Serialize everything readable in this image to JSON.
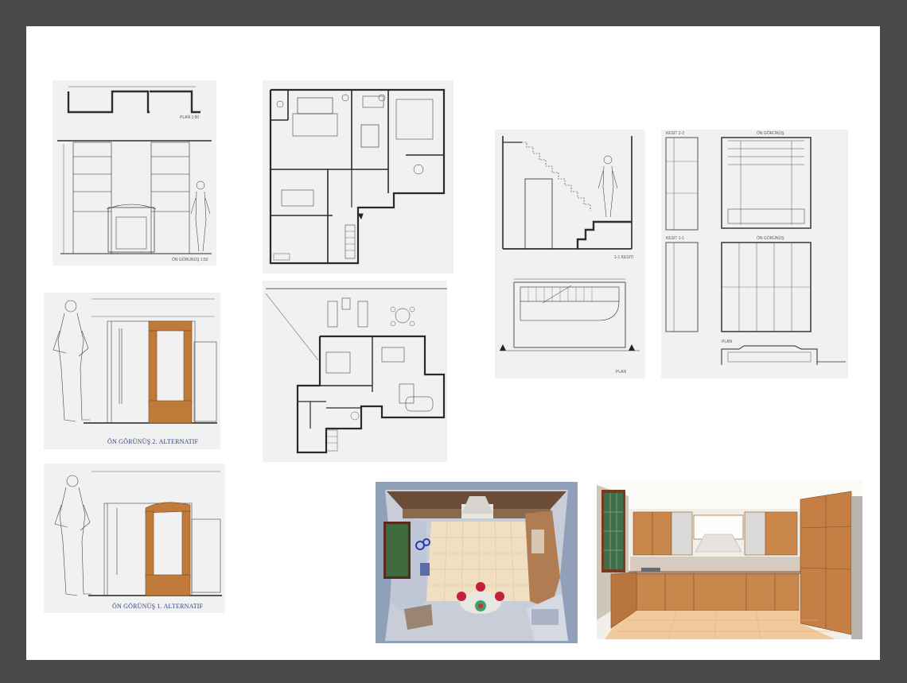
{
  "sheet": {
    "panels": {
      "plan_elevation": {
        "plan_label": "PLAN 1:50",
        "view_label": "ÖN GÖRÜNÜŞ 1:50"
      },
      "front_alt2": {
        "caption": "ÖN GÖRÜNÜŞ  2. ALTERNATIF"
      },
      "front_alt1": {
        "caption": "ÖN GÖRÜNÜŞ  1. ALTERNATIF"
      },
      "stair": {
        "section_label": "1-1 KESITI",
        "plan_label": "PLAN"
      },
      "cabinet": {
        "label_a": "KESIT 2-2",
        "label_b": "ÖN GÖRÜNÜŞ",
        "label_c": "KESIT 1-1",
        "label_d": "ÖN GÖRÜNÜŞ",
        "label_e": "PLAN"
      }
    },
    "colors": {
      "wood": "#c07a3a",
      "line": "#3a3a3a",
      "blue_caption": "#2b3f86"
    }
  }
}
